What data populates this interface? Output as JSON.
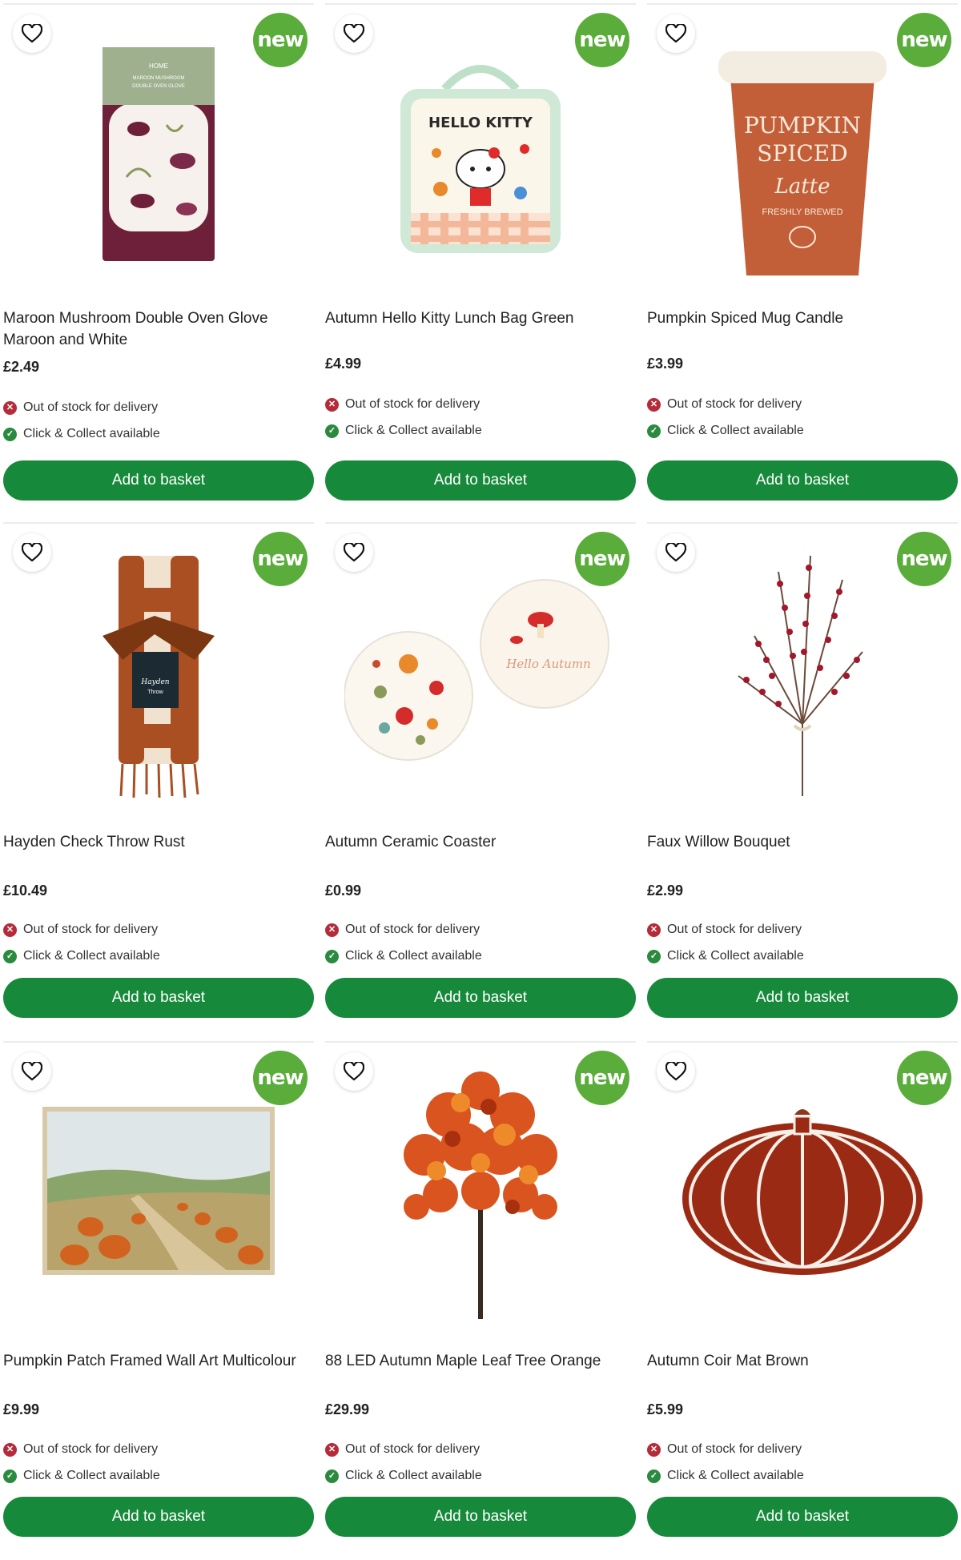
{
  "products": [
    {
      "name": "Maroon Mushroom Double Oven Glove Maroon and White",
      "price": "£2.49",
      "badge": "new",
      "delivery": "Out of stock for delivery",
      "collect": "Click & Collect available",
      "button": "Add to basket",
      "packaging_text": "HOME\nMAROON MUSHROOM\nDOUBLE OVEN GLOVE"
    },
    {
      "name": "Autumn Hello Kitty Lunch Bag Green",
      "price": "£4.99",
      "badge": "new",
      "delivery": "Out of stock for delivery",
      "collect": "Click & Collect available",
      "button": "Add to basket",
      "product_text": "HELLO KITTY"
    },
    {
      "name": "Pumpkin Spiced Mug Candle",
      "price": "£3.99",
      "badge": "new",
      "delivery": "Out of stock for delivery",
      "collect": "Click & Collect available",
      "button": "Add to basket",
      "product_text": "PUMPKIN\nSPICED\nLatte\nFRESHLY BREWED"
    },
    {
      "name": "Hayden Check Throw Rust",
      "price": "£10.49",
      "badge": "new",
      "delivery": "Out of stock for delivery",
      "collect": "Click & Collect available",
      "button": "Add to basket",
      "tag_text": "Hayden\nThrow"
    },
    {
      "name": "Autumn Ceramic Coaster",
      "price": "£0.99",
      "badge": "new",
      "delivery": "Out of stock for delivery",
      "collect": "Click & Collect available",
      "button": "Add to basket",
      "product_text": "Hello Autumn"
    },
    {
      "name": "Faux Willow Bouquet",
      "price": "£2.99",
      "badge": "new",
      "delivery": "Out of stock for delivery",
      "collect": "Click & Collect available",
      "button": "Add to basket"
    },
    {
      "name": "Pumpkin Patch Framed Wall Art Multicolour",
      "price": "£9.99",
      "badge": "new",
      "delivery": "Out of stock for delivery",
      "collect": "Click & Collect available",
      "button": "Add to basket"
    },
    {
      "name": "88 LED Autumn Maple Leaf Tree Orange",
      "price": "£29.99",
      "badge": "new",
      "delivery": "Out of stock for delivery",
      "collect": "Click & Collect available",
      "button": "Add to basket"
    },
    {
      "name": "Autumn Coir Mat Brown",
      "price": "£5.99",
      "badge": "new",
      "delivery": "Out of stock for delivery",
      "collect": "Click & Collect available",
      "button": "Add to basket"
    }
  ],
  "icons": {
    "favourite": "heart-outline-icon",
    "out_of_stock": "cross-circle-icon",
    "available": "check-circle-icon"
  },
  "colors": {
    "button": "#168a3a",
    "badge": "#5aad3a",
    "out_of_stock": "#b52b3a",
    "available": "#2a8a3e"
  }
}
